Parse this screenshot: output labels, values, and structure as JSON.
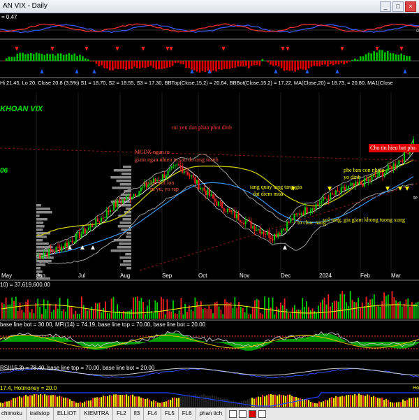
{
  "window": {
    "title": "AN VIX - Daily",
    "minimize": "_",
    "maximize": "□",
    "close": "×"
  },
  "panes": {
    "top1": {
      "label": "= 0.47",
      "right_label": "0"
    },
    "price": {
      "info": "Hi 21.45, Lo 20, Close 20.8 (3.5%) S1 = 18.70, S2 = 18.55, S3 = 17.30, BBTop(Close,15,2) = 20.64, BBBot(Close,15,2) = 17.22, MA(Close,20) = 18.73, = 20.80, MA1(Close",
      "name": "KHOAN VIX",
      "left_num": "06",
      "months": [
        "May",
        "Jun",
        "Jul",
        "Aug",
        "Sep",
        "Oct",
        "Nov",
        "Dec",
        "2024",
        "Feb",
        "Mar"
      ],
      "annotations": [
        {
          "text": "rui yen dan phan phoi dinh",
          "color": "#ff3b3b"
        },
        {
          "text": "MCDX ngan to",
          "color": "#ff5a3a"
        },
        {
          "text": "giam ngan nhieu to sau do tang manh",
          "color": "#ff5a3a"
        },
        {
          "text": "yo lan vol lon",
          "color": "#ff5a3a"
        },
        {
          "text": "ru yu, yo rap",
          "color": "#ff5a3a"
        },
        {
          "text": "tang quay tang tang gia",
          "color": "#ffff00"
        },
        {
          "text": "dat diem mua",
          "color": "#ffff00"
        },
        {
          "text": "phe ban con nhieu",
          "color": "#ffff00"
        },
        {
          "text": "yo dinh",
          "color": "#ffff00"
        },
        {
          "text": "to chuc nang",
          "color": "#ffff00"
        },
        {
          "text": "vol tang, gia giam khong tuong xung",
          "color": "#ffff00"
        },
        {
          "text": "Cho tin hieu bat pha",
          "color": "#ffffff"
        },
        {
          "text": "te",
          "color": "#ffffff"
        }
      ]
    },
    "volume": {
      "label": "10) = 37,619,600.00"
    },
    "mfi": {
      "label": "base line bot = 30.00, MFI(14) = 74.19, base line top = 70.00, base line bot = 20.00"
    },
    "rsi": {
      "label": "RSI(15,3) = 78.40, base line top = 70.00, base line bot = 20.00"
    },
    "hotmoney": {
      "label": "17.4, Hotmoney = 20.0",
      "right_label": "Ho"
    }
  },
  "tabs": [
    "chimoku",
    "trailstop",
    "ELLIOT",
    "KIEMTRA",
    "FL2",
    "fl3",
    "FL4",
    "FL5",
    "FL6",
    "phan tich"
  ],
  "colors": {
    "up": "#00d000",
    "down": "#ff2020",
    "yellow_line": "#c8c800",
    "bollinger": "#b0b0b0",
    "ma_blue": "#3aa0ff"
  },
  "chart_data": {
    "type": "candlestick",
    "x": [
      "May",
      "Jun",
      "Jul",
      "Aug",
      "Sep",
      "Oct",
      "Nov",
      "Dec",
      "2024",
      "Feb",
      "Mar"
    ],
    "close_last": 20.8,
    "high_last": 21.45,
    "low_last": 20,
    "indicators": {
      "S1": 18.7,
      "S2": 18.55,
      "S3": 17.3,
      "BBTop": 20.64,
      "BBBot": 17.22,
      "MA20": 18.73,
      "volume": 37619600,
      "MFI14": 74.19,
      "RSI": 78.4,
      "Hotmoney": 20.0
    },
    "close_series": [
      8.2,
      8.5,
      8.9,
      9.4,
      10.1,
      10.8,
      11.6,
      12.4,
      13.5,
      14.2,
      14.8,
      15.4,
      16.1,
      16.6,
      17.3,
      18.0,
      17.4,
      16.1,
      15.2,
      14.1,
      13.4,
      12.6,
      12.1,
      11.4,
      10.9,
      10.3,
      11.0,
      12.1,
      12.9,
      13.4,
      14.0,
      14.6,
      15.1,
      15.6,
      15.9,
      16.3,
      16.8,
      17.4,
      18.2,
      19.0,
      20.8
    ]
  }
}
